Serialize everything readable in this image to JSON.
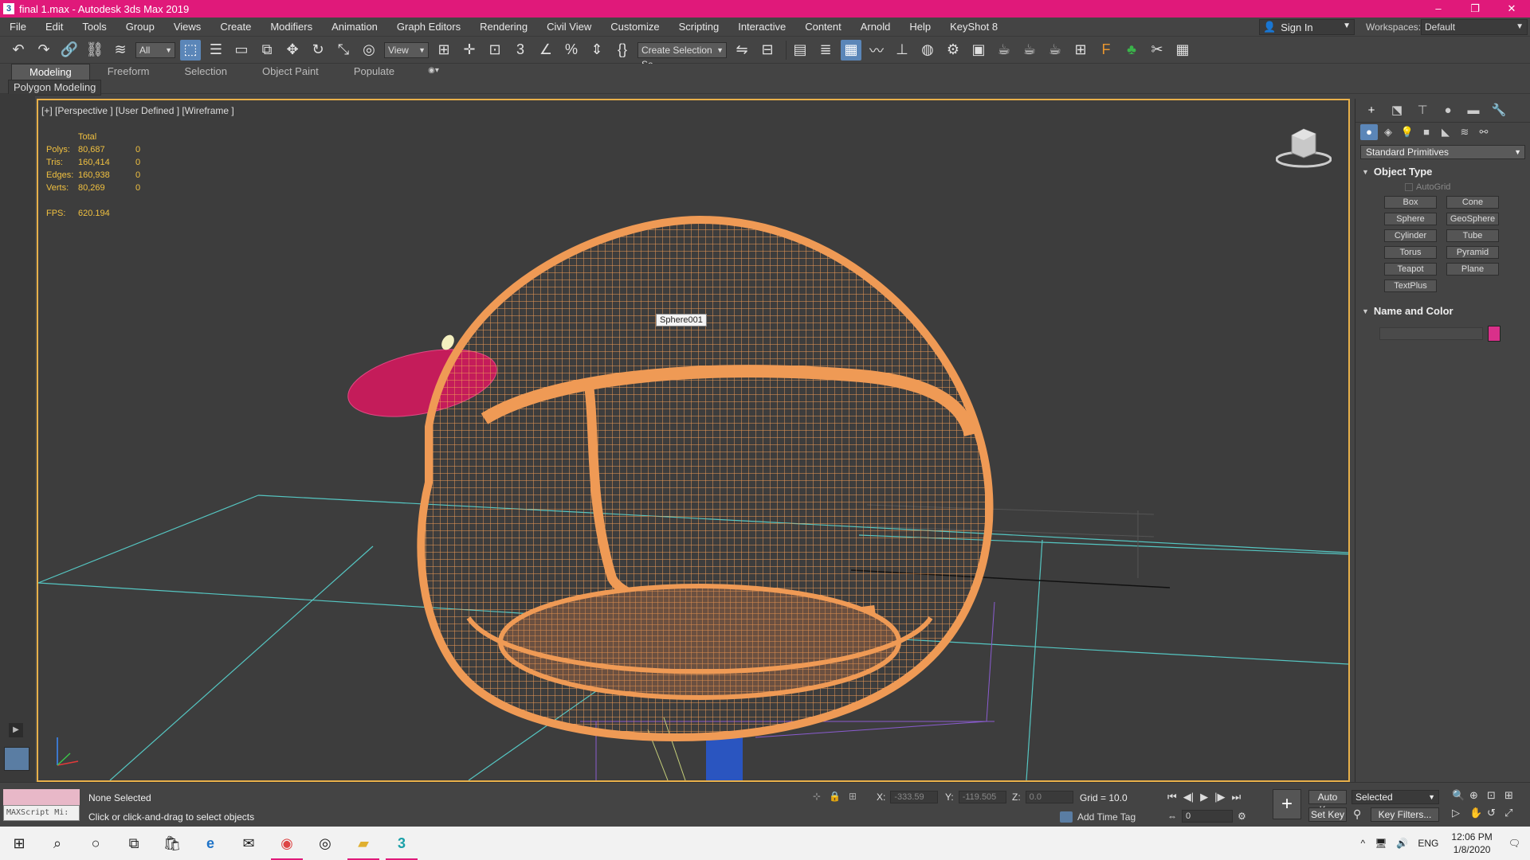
{
  "window": {
    "title": "final 1.max - Autodesk 3ds Max 2019",
    "app_icon": "3"
  },
  "menubar": {
    "items": [
      "File",
      "Edit",
      "Tools",
      "Group",
      "Views",
      "Create",
      "Modifiers",
      "Animation",
      "Graph Editors",
      "Rendering",
      "Civil View",
      "Customize",
      "Scripting",
      "Interactive",
      "Content",
      "Arnold",
      "Help",
      "KeyShot 8"
    ],
    "sign_in": "Sign In",
    "workspaces_label": "Workspaces:",
    "workspace_value": "Default"
  },
  "toolbar": {
    "filter_select": "All",
    "ref_coord_select": "View",
    "selection_set_select": "Create Selection Se"
  },
  "ribbon": {
    "tabs": [
      "Modeling",
      "Freeform",
      "Selection",
      "Object Paint",
      "Populate"
    ],
    "active_tab": "Modeling",
    "sub_label": "Polygon Modeling"
  },
  "viewport": {
    "label": "[+] [Perspective ] [User Defined ] [Wireframe ]",
    "stats_header": "Total",
    "stats": [
      {
        "label": "Polys:",
        "total": "80,687",
        "sel": "0"
      },
      {
        "label": "Tris:",
        "total": "160,414",
        "sel": "0"
      },
      {
        "label": "Edges:",
        "total": "160,938",
        "sel": "0"
      },
      {
        "label": "Verts:",
        "total": "80,269",
        "sel": "0"
      }
    ],
    "fps_label": "FPS:",
    "fps_value": "620.194",
    "object_tooltip": "Sphere001",
    "wire_color": "#ef9a55",
    "accent_wire_color": "#d0205e"
  },
  "command_panel": {
    "category": "Standard Primitives",
    "object_type_title": "Object Type",
    "autogrid": "AutoGrid",
    "primitives": [
      "Box",
      "Cone",
      "Sphere",
      "GeoSphere",
      "Cylinder",
      "Tube",
      "Torus",
      "Pyramid",
      "Teapot",
      "Plane",
      "TextPlus"
    ],
    "name_color_title": "Name and Color",
    "swatch_color": "#d9308a"
  },
  "status": {
    "listener_text": "MAXScript Mi:",
    "selection": "None Selected",
    "prompt": "Click or click-and-drag to select objects",
    "x_label": "X:",
    "x_value": "-333.59",
    "y_label": "Y:",
    "y_value": "-119.505",
    "z_label": "Z:",
    "z_value": "0.0",
    "grid": "Grid = 10.0",
    "add_time_tag": "Add Time Tag",
    "frame_value": "0",
    "auto_key": "Auto Key",
    "set_key": "Set Key",
    "selected_dropdown": "Selected",
    "key_filters": "Key Filters..."
  },
  "taskbar": {
    "language": "ENG",
    "time": "12:06 PM",
    "date": "1/8/2020"
  }
}
